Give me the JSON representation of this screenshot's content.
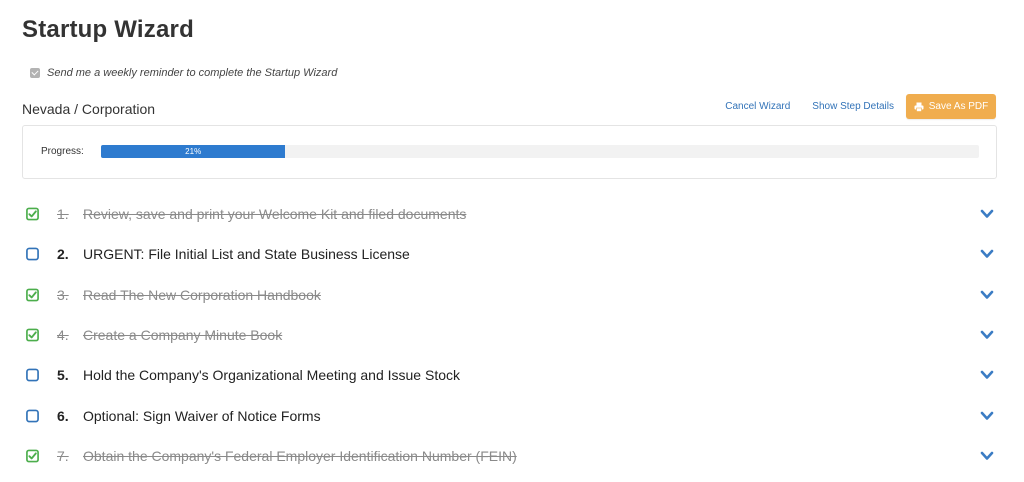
{
  "page": {
    "title": "Startup Wizard",
    "reminder_label": "Send me a weekly reminder to complete the Startup Wizard",
    "reminder_checked": true
  },
  "header": {
    "state_entity": "Nevada / Corporation",
    "cancel_label": "Cancel Wizard",
    "details_label": "Show Step Details",
    "save_pdf_label": "Save As PDF"
  },
  "progress": {
    "label": "Progress:",
    "value": 21,
    "value_text": "21%"
  },
  "steps": [
    {
      "num": "1.",
      "label": "Review, save and print your Welcome Kit and filed documents",
      "done": true
    },
    {
      "num": "2.",
      "label": "URGENT: File Initial List and State Business License",
      "done": false
    },
    {
      "num": "3.",
      "label": "Read The New Corporation Handbook",
      "done": true
    },
    {
      "num": "4.",
      "label": "Create a Company Minute Book",
      "done": true
    },
    {
      "num": "5.",
      "label": "Hold the Company's Organizational Meeting and Issue Stock",
      "done": false
    },
    {
      "num": "6.",
      "label": "Optional: Sign Waiver of Notice Forms",
      "done": false
    },
    {
      "num": "7.",
      "label": "Obtain the Company's Federal Employer Identification Number (FEIN)",
      "done": true
    }
  ],
  "colors": {
    "accent_blue": "#3273b8",
    "progress_fill": "#2e7bcf",
    "check_green": "#4cae4c",
    "pdf_orange": "#f0ad4e",
    "chevron": "#3b7cc4"
  },
  "icons": {
    "done": "checkbox-checked-icon",
    "todo": "checkbox-empty-icon",
    "expand": "chevron-down-icon",
    "pdf": "printer-icon"
  }
}
